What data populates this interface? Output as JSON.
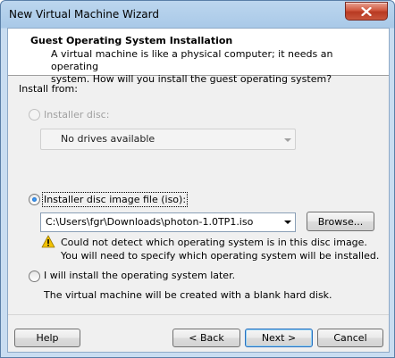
{
  "window": {
    "title": "New Virtual Machine Wizard"
  },
  "header": {
    "title": "Guest Operating System Installation",
    "subtitle_line1": "A virtual machine is like a physical computer; it needs an operating",
    "subtitle_line2": "system. How will you install the guest operating system?"
  },
  "install_from": {
    "label": "Install from:",
    "installer_disc": {
      "label": "Installer disc:",
      "enabled": false,
      "selected": false,
      "dropdown_value": "No drives available"
    },
    "iso_option": {
      "label": "Installer disc image file (iso):",
      "selected": true,
      "path_value": "C:\\Users\\fgr\\Downloads\\photon-1.0TP1.iso",
      "browse_label": "Browse...",
      "warning_line1": "Could not detect which operating system is in this disc image.",
      "warning_line2": "You will need to specify which operating system will be installed."
    },
    "later_option": {
      "label": "I will install the operating system later.",
      "selected": false,
      "description": "The virtual machine will be created with a blank hard disk."
    }
  },
  "footer": {
    "help_label": "Help",
    "back_label": "< Back",
    "next_label": "Next >",
    "cancel_label": "Cancel"
  },
  "icons": {
    "close": "close-icon",
    "warning": "warning-icon",
    "dropdown": "chevron-down-icon"
  },
  "colors": {
    "title_bar": "#a9c9e8",
    "close_button": "#c9563d",
    "dialog_bg": "#f0f0f0",
    "header_bg": "#ffffff",
    "warning": "#f2c200"
  }
}
